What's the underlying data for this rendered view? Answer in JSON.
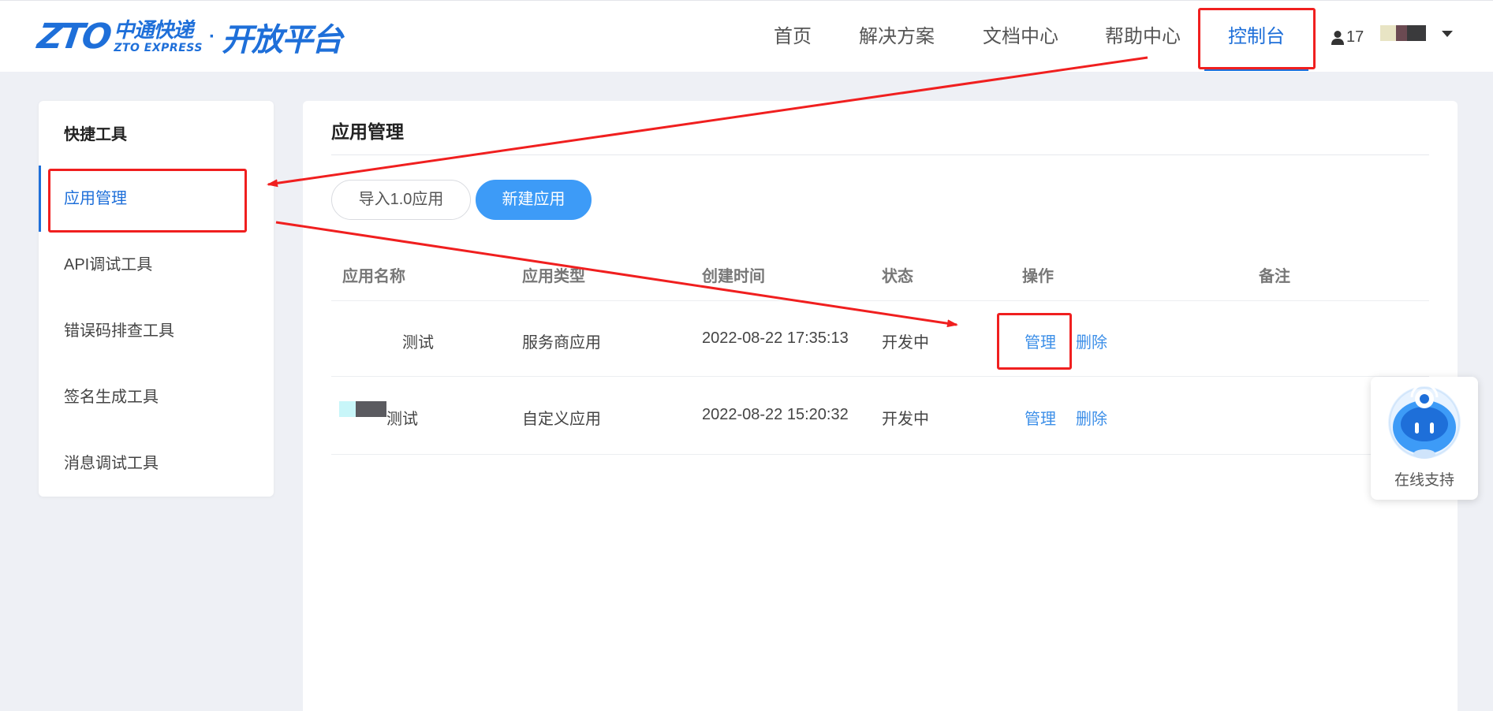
{
  "logo": {
    "brand_mark": "ZTO",
    "brand_cn": "中通快递",
    "brand_en": "ZTO EXPRESS",
    "separator": "·",
    "platform": "开放平台"
  },
  "nav": {
    "items": [
      {
        "label": "首页"
      },
      {
        "label": "解决方案"
      },
      {
        "label": "文档中心"
      },
      {
        "label": "帮助中心"
      },
      {
        "label": "控制台"
      }
    ],
    "active_index": 4,
    "user_count": "17",
    "accent_color": "#1e6fd9"
  },
  "sidebar": {
    "title": "快捷工具",
    "items": [
      {
        "label": "应用管理"
      },
      {
        "label": "API调试工具"
      },
      {
        "label": "错误码排查工具"
      },
      {
        "label": "签名生成工具"
      },
      {
        "label": "消息调试工具"
      }
    ],
    "active_index": 0
  },
  "main": {
    "title": "应用管理",
    "buttons": {
      "import": "导入1.0应用",
      "create": "新建应用"
    },
    "table": {
      "headers": [
        "应用名称",
        "应用类型",
        "创建时间",
        "状态",
        "操作",
        "备注"
      ],
      "rows": [
        {
          "name": "测试",
          "type": "服务商应用",
          "created": "2022-08-22 17:35:13",
          "status": "开发中",
          "action_manage": "管理",
          "action_delete": "删除",
          "note": ""
        },
        {
          "name": "测试",
          "type": "自定义应用",
          "created": "2022-08-22 15:20:32",
          "status": "开发中",
          "action_manage": "管理",
          "action_delete": "删除",
          "note": ""
        }
      ]
    }
  },
  "support": {
    "label": "在线支持"
  },
  "annotation_color": "#f01f1f"
}
